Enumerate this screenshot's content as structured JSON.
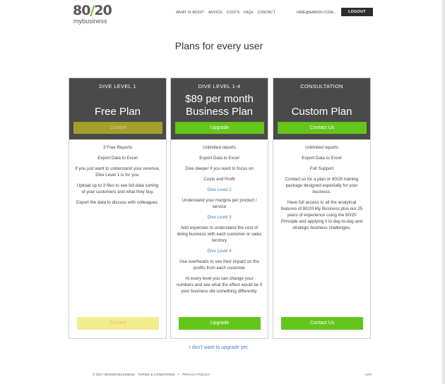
{
  "header": {
    "logo_main": "80",
    "logo_slash": "/",
    "logo_tail": "20",
    "logo_tm": "TM",
    "logo_sub": "mybusiness",
    "nav": [
      "WHAT IS 80/20?",
      "ADVICE",
      "COSTS",
      "FAQs",
      "CONTACT"
    ],
    "user_email": "HIRE@AARON.CODE...",
    "logout": "LOGOUT"
  },
  "page_title": "Plans for every user",
  "plans": [
    {
      "level": "DIVE LEVEL 1",
      "name_line1": "Free Plan",
      "name_line2": "",
      "head_button": "Current",
      "features": [
        "3 Free Reports",
        "Export Data to Excel",
        "If you just want to understand your revenue, Dive Level 1 is for you.",
        "Upload up to 3 files to see full data sorting of your customers and what they buy.",
        "Export the data to discuss with colleagues."
      ],
      "foot_button": "Current"
    },
    {
      "level": "DIVE LEVEL 1-4",
      "name_line1": "$89 per month",
      "name_line2": "Business Plan",
      "head_button": "Upgrade",
      "features": [
        "Unlimited reports",
        "Export Data to Excel",
        "Dive deeper if you want to focus on",
        "Costs and Profit",
        "Dive Level 2",
        "Understand your margins per product / service",
        "Dive Level 3",
        "Add expenses to understand the cost of doing business with each customer or sales territory",
        "Dive Level 4",
        "Use overheads to see their impact on the profits from each customer",
        "At every level you can change your numbers and see what the effect would be if your business did something differently."
      ],
      "foot_button": "Upgrade"
    },
    {
      "level": "CONSULTATION",
      "name_line1": "Custom Plan",
      "name_line2": "",
      "head_button": "Contact Us",
      "features": [
        "Unlimited reports",
        "Export Data to Excel",
        "Full Support",
        "Contact us for a plan or 80/20 training package designed especially for your business.",
        "Have full access to all the analytical features of 80/20 My Business plus our 25 years of experience using the 80/20 Principle and applying it to day-to-day and strategic business challenges."
      ],
      "foot_button": "Contact Us"
    }
  ],
  "no_upgrade": "I don't want to upgrade yet.",
  "footer": {
    "copyright": "© 2017 80/20MYBUSINESS",
    "terms": "TERMS & CONDITIONS",
    "sep": "•",
    "privacy": "PRIVACY POLICY",
    "right": "LYO"
  },
  "colors": {
    "accent_green": "#64c51b",
    "header_dark": "#4a4a4a",
    "current_olive": "#a69e2c",
    "current_light": "#f5ec8d",
    "link_blue": "#3f7fc7"
  }
}
